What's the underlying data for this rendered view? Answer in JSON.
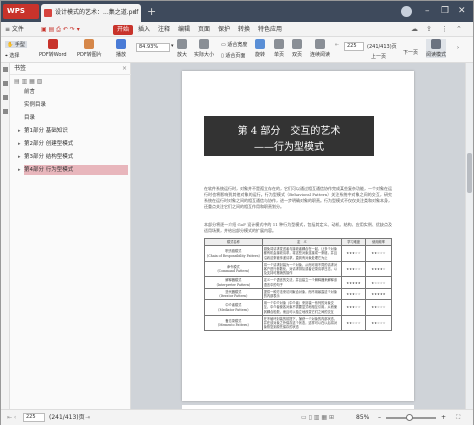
{
  "titlebar": {
    "app": "WPS",
    "tab_title": "设计模式的艺术：...集之道.pdf",
    "tab_close": "×",
    "new_tab": "+",
    "min": "–",
    "restore": "❐",
    "close": "✕"
  },
  "menubar": {
    "file": "≡ 文件",
    "items": [
      "开始",
      "插入",
      "注释",
      "编辑",
      "页面",
      "保护",
      "转换",
      "特色应用"
    ],
    "start_badge": "开始"
  },
  "toolbar": {
    "hand": "手型",
    "select": "选择",
    "pdf_to_word": "PDF转Word",
    "pdf_to_image": "PDF转图片",
    "play": "播放",
    "zoom_value": "84.93%",
    "zoom_in": "放大",
    "actual_size": "实际大小",
    "fit_width": "适合宽度",
    "fit_page": "适合页面",
    "rotate": "旋转",
    "single": "单页",
    "double": "双页",
    "continuous": "连续阅读",
    "page_input": "225",
    "page_count": "(241/413)页",
    "prev": "上一页",
    "next": "下一页",
    "read_mode": "阅读模式"
  },
  "bookmarks": {
    "header": "书签",
    "items": [
      {
        "label": "前言",
        "arrow": ""
      },
      {
        "label": "实例目录",
        "arrow": ""
      },
      {
        "label": "目录",
        "arrow": ""
      },
      {
        "label": "第1部分 基础知识",
        "arrow": "▸"
      },
      {
        "label": "第2部分 创建型模式",
        "arrow": "▸"
      },
      {
        "label": "第3部分 结构型模式",
        "arrow": "▸"
      },
      {
        "label": "第4部分 行为型模式",
        "arrow": "▸"
      }
    ]
  },
  "page": {
    "banner_line1": "第 4 部分　交互的艺术",
    "banner_line2": "——行为型模式",
    "para1": "在软件系统运行时，对象并不是孤立存在的，它们可以通过相互通信协作完成某些复杂功能，一个对象在运行时也将影响到其他对象的运行。行为型模式（Behavioral Pattern）关注系统中对象之间的交互，研究系统在运行时对象之间的相互通信与协作，进一步明确对象的职责。行为型模式不仅仅关注类和对象本身，还重点关注它们之间的相互作用和职责划分。",
    "para2": "本部分将逐一介绍 GoF 设计模式中的 11 种行为型模式，包括其定义、动机、结构、应用实例、优缺点及适用场景，并给出部分模式的扩展内容。",
    "table_header": [
      "模式名称",
      "定　义",
      "学习难度",
      "使用频率"
    ],
    "rows": [
      {
        "name": "职责链模式",
        "en": "(Chain of Responsibility Pattern)",
        "def": "避免将请求发送者与接收者耦合在一起，让多个对象都有机会接收请求，将这些对象连接成一条链，并且沿着这条链传递请求，直到有对象处理它为止",
        "diff": "★★★☆☆",
        "freq": "★★☆☆☆"
      },
      {
        "name": "命令模式",
        "en": "(Command Pattern)",
        "def": "将一个请求封装为一个对象，从而可用不同的请求对客户进行参数化，对请求排队或者记录请求日志，以及支持可撤销的操作",
        "diff": "★★★☆☆",
        "freq": "★★★★☆"
      },
      {
        "name": "解释器模式",
        "en": "(Interpreter Pattern)",
        "def": "定义一个语言的文法，并且建立一个解释器来解释该语言中的句子",
        "diff": "★★★★★",
        "freq": "★☆☆☆☆"
      },
      {
        "name": "迭代器模式",
        "en": "(Iterator Pattern)",
        "def": "提供一种方法来访问聚合对象，而不用暴露这个对象的内部表示",
        "diff": "★★★☆☆",
        "freq": "★★★★★"
      },
      {
        "name": "中介者模式",
        "en": "(Mediator Pattern)",
        "def": "用一个中介对象（中介者）来封装一系列的对象交互，中介者使各对象不需要显式地相互引用，从而使其耦合松散，而且可以独立地改变它们之间的交互",
        "diff": "★★★☆☆",
        "freq": "★★☆☆☆"
      },
      {
        "name": "备忘录模式",
        "en": "(Memento Pattern)",
        "def": "在不破坏封装的前提下，捕获一个对象的内部状态，并在该对象之外保存这个状态，这样可以在以后将对象恢复到原先保存的状态",
        "diff": "★★☆☆☆",
        "freq": "★★☆☆☆"
      }
    ]
  },
  "statusbar": {
    "page_input": "225",
    "page_count": "(241/413)页",
    "zoom": "85%",
    "zoom_minus": "–",
    "zoom_plus": "+"
  },
  "colors": {
    "accent": "#c8332b",
    "titlebar": "#3e4a5c",
    "bookmark_selected": "#e8b6bc"
  }
}
